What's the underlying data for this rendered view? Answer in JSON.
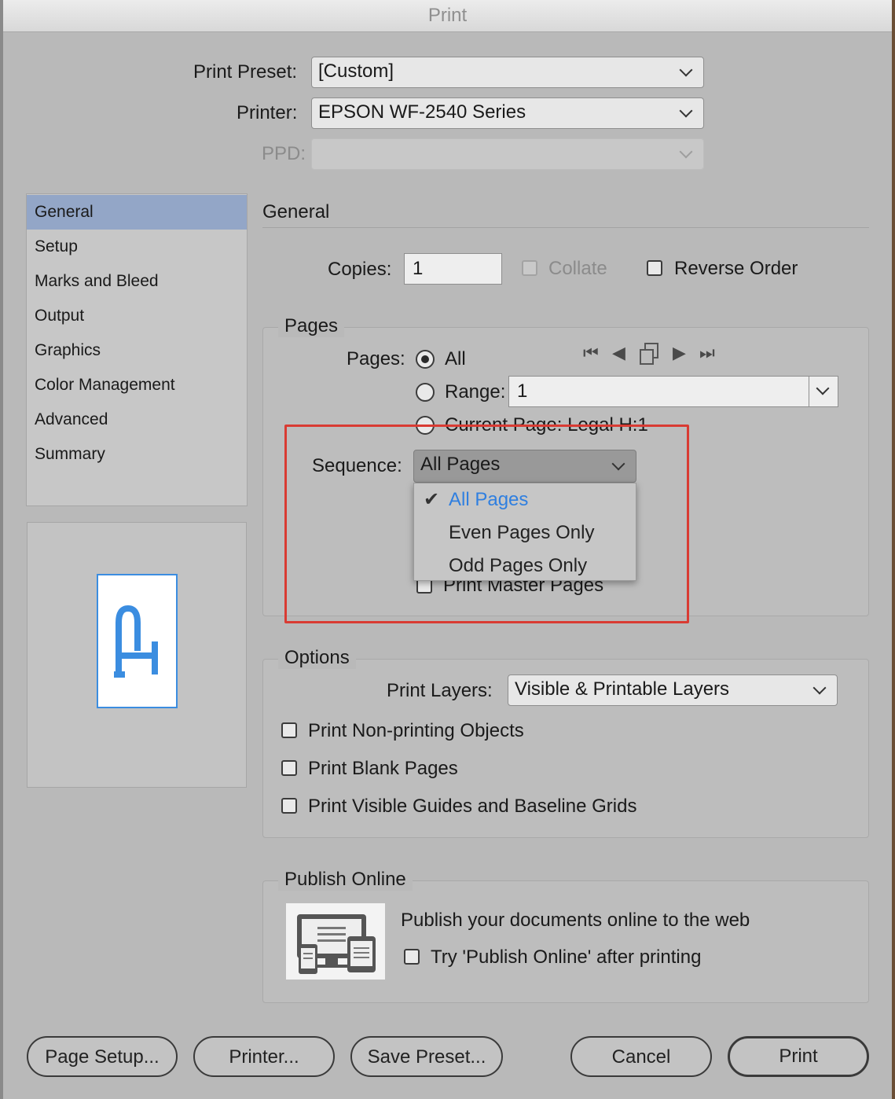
{
  "window": {
    "title": "Print"
  },
  "header": {
    "preset_label": "Print Preset:",
    "preset_value": "[Custom]",
    "printer_label": "Printer:",
    "printer_value": "EPSON WF-2540 Series",
    "ppd_label": "PPD:",
    "ppd_value": ""
  },
  "sidebar": {
    "items": [
      {
        "label": "General",
        "active": true
      },
      {
        "label": "Setup"
      },
      {
        "label": "Marks and Bleed"
      },
      {
        "label": "Output"
      },
      {
        "label": "Graphics"
      },
      {
        "label": "Color Management"
      },
      {
        "label": "Advanced"
      },
      {
        "label": "Summary"
      }
    ]
  },
  "general": {
    "title": "General",
    "copies_label": "Copies:",
    "copies_value": "1",
    "collate_label": "Collate",
    "reverse_label": "Reverse Order"
  },
  "pages": {
    "group_title": "Pages",
    "pages_label": "Pages:",
    "all_label": "All",
    "range_label": "Range:",
    "range_value": "1",
    "current_label": "Current Page: Legal H:1",
    "sequence_label": "Sequence:",
    "sequence_value": "All Pages",
    "sequence_options": [
      "All Pages",
      "Even Pages Only",
      "Odd Pages Only"
    ],
    "master_label": "Print Master Pages"
  },
  "options": {
    "group_title": "Options",
    "layers_label": "Print Layers:",
    "layers_value": "Visible & Printable Layers",
    "nonprinting_label": "Print Non-printing Objects",
    "blank_label": "Print Blank Pages",
    "guides_label": "Print Visible Guides and Baseline Grids"
  },
  "publish": {
    "group_title": "Publish Online",
    "text": "Publish your documents online to the web",
    "try_label": "Try 'Publish Online' after printing"
  },
  "buttons": {
    "page_setup": "Page Setup...",
    "printer": "Printer...",
    "save_preset": "Save Preset...",
    "cancel": "Cancel",
    "print": "Print"
  },
  "colors": {
    "accent": "#2f7fe0",
    "highlight": "#d93b33",
    "sidebar_active": "#93a6c7"
  },
  "icons": [
    "chevron-down-icon",
    "first-page-icon",
    "prev-page-icon",
    "spreads-icon",
    "next-page-icon",
    "last-page-icon",
    "checkmark-icon",
    "devices-icon",
    "page-preview-icon"
  ]
}
